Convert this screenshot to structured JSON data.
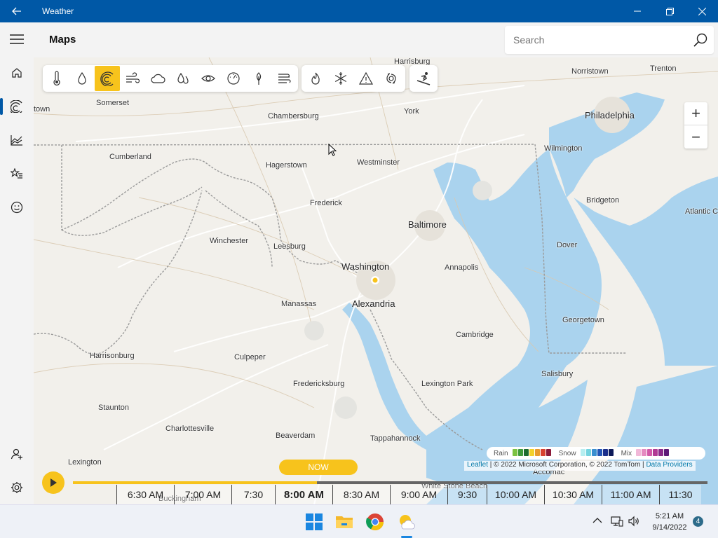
{
  "window": {
    "title": "Weather",
    "back_icon": "back-arrow-icon",
    "controls": [
      "minimize-icon",
      "maximize-icon",
      "close-icon"
    ]
  },
  "header": {
    "page_title": "Maps"
  },
  "search": {
    "placeholder": "Search"
  },
  "nav": {
    "items": [
      "menu-icon",
      "home-icon",
      "maps-icon",
      "charts-icon",
      "favorites-icon",
      "feedback-icon",
      "account-icon",
      "settings-icon"
    ],
    "active": "maps-icon"
  },
  "toolbar": {
    "layers": [
      "temperature-icon",
      "precipitation-icon",
      "radar-icon",
      "wind-icon",
      "clouds-icon",
      "humidity-icon",
      "visibility-icon",
      "pressure-icon",
      "pollen-icon",
      "air-quality-icon"
    ],
    "active_layer": "radar-icon",
    "hazards": [
      "fire-icon",
      "winter-icon",
      "severe-weather-icon",
      "hurricane-icon"
    ],
    "sports": [
      "ski-icon"
    ]
  },
  "map": {
    "cities": [
      {
        "name": "Harrisburg"
      },
      {
        "name": "Norristown"
      },
      {
        "name": "Trenton"
      },
      {
        "name": "Somerset"
      },
      {
        "name": "town"
      },
      {
        "name": "Chambersburg"
      },
      {
        "name": "York"
      },
      {
        "name": "Philadelphia"
      },
      {
        "name": "Cumberland"
      },
      {
        "name": "Hagerstown"
      },
      {
        "name": "Westminster"
      },
      {
        "name": "Wilmington"
      },
      {
        "name": "Frederick"
      },
      {
        "name": "Bridgeton"
      },
      {
        "name": "Atlantic C"
      },
      {
        "name": "Baltimore"
      },
      {
        "name": "Winchester"
      },
      {
        "name": "Leesburg"
      },
      {
        "name": "Dover"
      },
      {
        "name": "Washington"
      },
      {
        "name": "Annapolis"
      },
      {
        "name": "Manassas"
      },
      {
        "name": "Alexandria"
      },
      {
        "name": "Georgetown"
      },
      {
        "name": "Cambridge"
      },
      {
        "name": "Harrisonburg"
      },
      {
        "name": "Culpeper"
      },
      {
        "name": "Salisbury"
      },
      {
        "name": "Fredericksburg"
      },
      {
        "name": "Lexington Park"
      },
      {
        "name": "Staunton"
      },
      {
        "name": "Charlottesville"
      },
      {
        "name": "Beaverdam"
      },
      {
        "name": "Tappahannock"
      },
      {
        "name": "Lexington"
      },
      {
        "name": "Accomac"
      },
      {
        "name": "White Stone Beach"
      },
      {
        "name": "Buckingham"
      }
    ],
    "zoom_in": "+",
    "zoom_out": "−",
    "legend": {
      "rain": "Rain",
      "snow": "Snow",
      "mix": "Mix",
      "rain_colors": [
        "#7cc242",
        "#3e9a3a",
        "#1d6b2e",
        "#f3d12b",
        "#e89b2c",
        "#d8412f",
        "#8b1a3a"
      ],
      "snow_colors": [
        "#b6eef0",
        "#74d3df",
        "#3a8fd0",
        "#2255b5",
        "#1a2e8c",
        "#0d1a5a"
      ],
      "mix_colors": [
        "#f1b8d8",
        "#e58ac0",
        "#d25aa8",
        "#b13a94",
        "#8a2a8a",
        "#5e1a78"
      ]
    },
    "attribution": {
      "leaflet": "Leaflet",
      "text": " | © 2022 Microsoft Corporation, © 2022 TomTom | ",
      "providers": "Data Providers"
    }
  },
  "timeline": {
    "now_label": "NOW",
    "progress": 0.385,
    "ticks": [
      "6:30 AM",
      "7:00 AM",
      "7:30",
      "8:00 AM",
      "8:30 AM",
      "9:00 AM",
      "9:30",
      "10:00 AM",
      "10:30 AM",
      "11:00 AM",
      "11:30"
    ],
    "current": "8:00 AM"
  },
  "taskbar": {
    "apps": [
      "windows-start-icon",
      "file-explorer-icon",
      "chrome-icon",
      "weather-app-icon"
    ],
    "tray": [
      "chevron-up-icon",
      "network-icon",
      "volume-icon"
    ],
    "time": "5:21 AM",
    "date": "9/14/2022",
    "notifications": "4"
  }
}
